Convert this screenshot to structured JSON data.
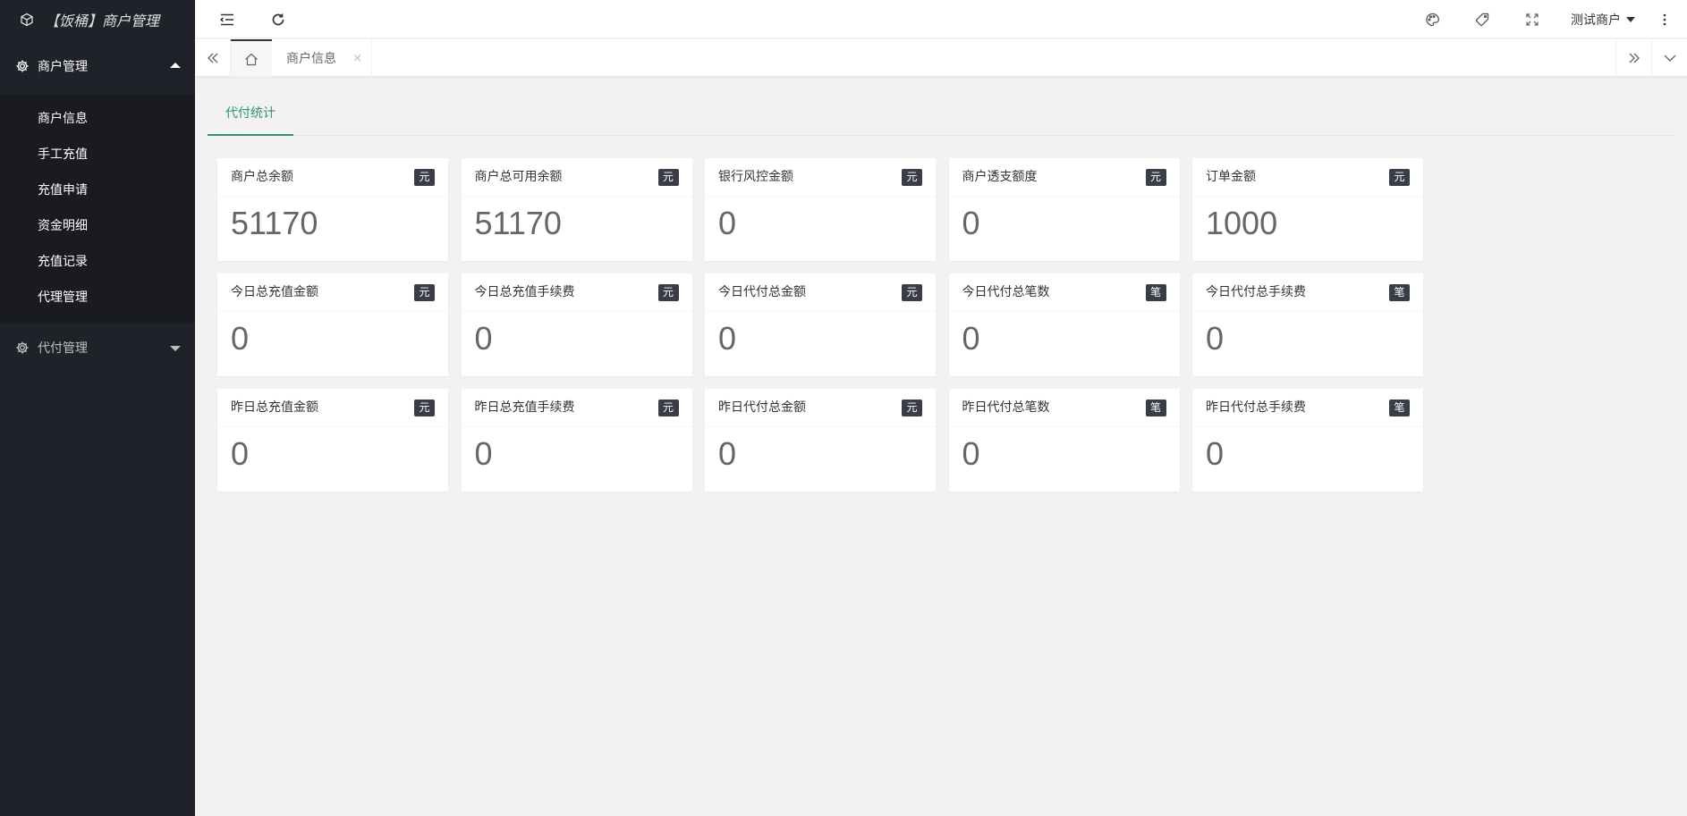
{
  "app": {
    "title": "【饭桶】商户管理"
  },
  "sidebar": {
    "groups": [
      {
        "label": "商户管理",
        "expanded": true,
        "items": [
          "商户信息",
          "手工充值",
          "充值申请",
          "资金明细",
          "充值记录",
          "代理管理"
        ]
      },
      {
        "label": "代付管理",
        "expanded": false,
        "items": []
      }
    ]
  },
  "header": {
    "icons": [
      "menu-fold-icon",
      "refresh-icon",
      "theme-icon",
      "tag-icon",
      "fullscreen-icon",
      "more-icon"
    ],
    "user_label": "测试商户"
  },
  "tabs": {
    "home_icon": "home-icon",
    "open": [
      {
        "label": "商户信息",
        "close": "×"
      }
    ]
  },
  "content": {
    "tab_label": "代付统计",
    "cards": [
      {
        "label": "商户总余额",
        "badge": "元",
        "value": "51170"
      },
      {
        "label": "商户总可用余额",
        "badge": "元",
        "value": "51170"
      },
      {
        "label": "银行风控金额",
        "badge": "元",
        "value": "0"
      },
      {
        "label": "商户透支额度",
        "badge": "元",
        "value": "0"
      },
      {
        "label": "订单金额",
        "badge": "元",
        "value": "1000"
      },
      {
        "label": "今日总充值金额",
        "badge": "元",
        "value": "0"
      },
      {
        "label": "今日总充值手续费",
        "badge": "元",
        "value": "0"
      },
      {
        "label": "今日代付总金额",
        "badge": "元",
        "value": "0"
      },
      {
        "label": "今日代付总笔数",
        "badge": "笔",
        "value": "0"
      },
      {
        "label": "今日代付总手续费",
        "badge": "笔",
        "value": "0"
      },
      {
        "label": "昨日总充值金额",
        "badge": "元",
        "value": "0"
      },
      {
        "label": "昨日总充值手续费",
        "badge": "元",
        "value": "0"
      },
      {
        "label": "昨日代付总金额",
        "badge": "元",
        "value": "0"
      },
      {
        "label": "昨日代付总笔数",
        "badge": "笔",
        "value": "0"
      },
      {
        "label": "昨日代付总手续费",
        "badge": "笔",
        "value": "0"
      }
    ]
  },
  "colors": {
    "sidebar_bg": "#20222a",
    "submenu_bg": "#1a1b20",
    "accent": "#2b9670",
    "badge_bg": "#393d49",
    "page_bg": "#f2f2f2"
  }
}
